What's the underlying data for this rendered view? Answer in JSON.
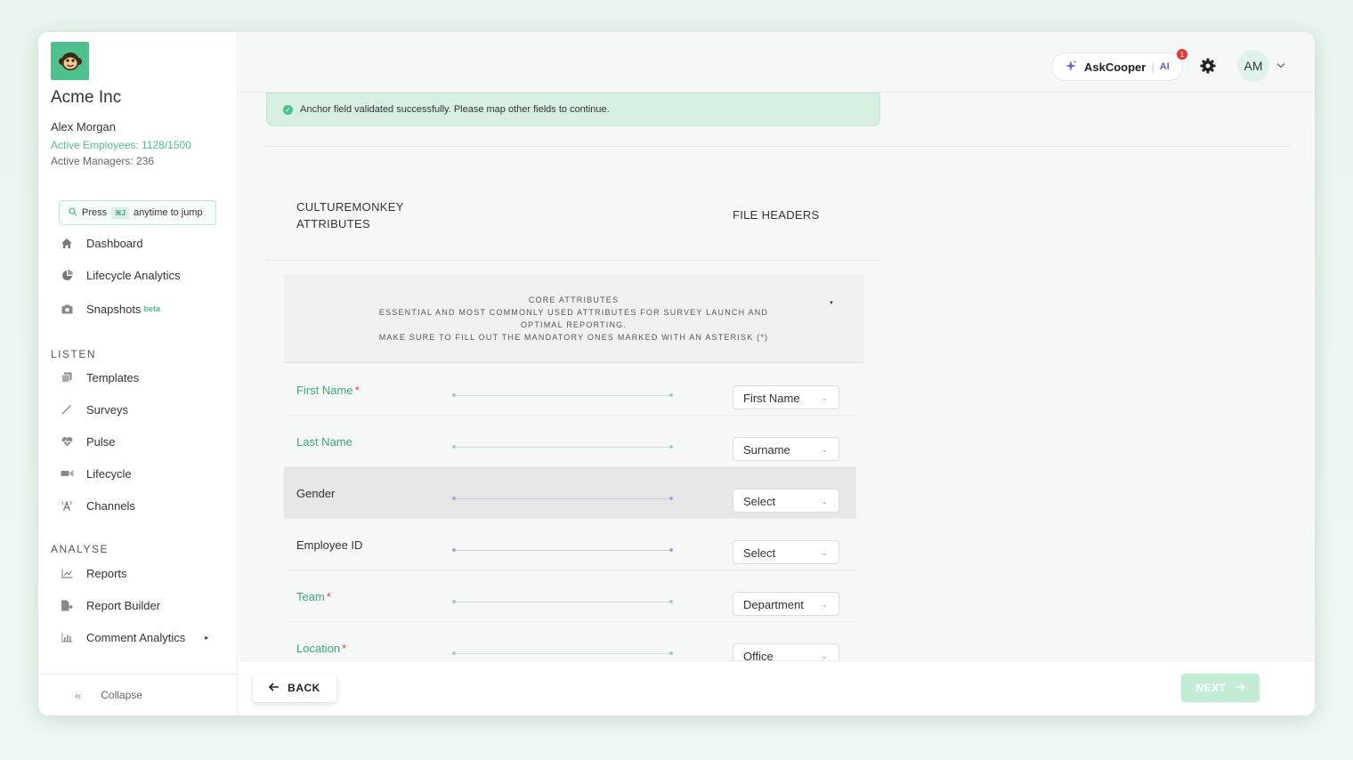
{
  "sidebar": {
    "company": "Acme Inc",
    "user_name": "Alex Morgan",
    "active_employees": "Active Employees: 1128/1500",
    "active_managers": "Active Managers: 236",
    "jump": {
      "press": "Press",
      "shortcut": "⌘J",
      "rest": "anytime to jump"
    },
    "items_main": [
      {
        "label": "Dashboard",
        "icon": "home-icon"
      },
      {
        "label": "Lifecycle Analytics",
        "icon": "pie-chart-icon"
      },
      {
        "label": "Snapshots",
        "icon": "camera-icon",
        "badge": "beta"
      }
    ],
    "section_listen": "LISTEN",
    "items_listen": [
      {
        "label": "Templates",
        "icon": "templates-icon"
      },
      {
        "label": "Surveys",
        "icon": "pen-icon"
      },
      {
        "label": "Pulse",
        "icon": "heartbeat-icon"
      },
      {
        "label": "Lifecycle",
        "icon": "lifecycle-icon"
      },
      {
        "label": "Channels",
        "icon": "broadcast-icon"
      }
    ],
    "section_analyse": "ANALYSE",
    "items_analyse": [
      {
        "label": "Reports",
        "icon": "line-chart-icon"
      },
      {
        "label": "Report Builder",
        "icon": "report-builder-icon"
      },
      {
        "label": "Comment Analytics",
        "icon": "bar-chart-icon"
      }
    ],
    "collapse": "Collapse"
  },
  "topbar": {
    "askcooper": "AskCooper",
    "ai": "AI",
    "notification_count": "1",
    "avatar_initials": "AM"
  },
  "toast": "Anchor field validated successfully. Please map other fields to continue.",
  "columns": {
    "left_line1": "CULTUREMONKEY",
    "left_line2": "ATTRIBUTES",
    "right": "FILE HEADERS"
  },
  "core": {
    "title": "CORE ATTRIBUTES",
    "line2": "ESSENTIAL AND MOST COMMONLY USED ATTRIBUTES FOR SURVEY LAUNCH AND OPTIMAL REPORTING.",
    "line3": "MAKE SURE TO FILL OUT THE MANDATORY ONES MARKED WITH AN ASTERISK (*)"
  },
  "rows": [
    {
      "label": "First Name",
      "required": "*",
      "value": "First Name"
    },
    {
      "label": "Last Name",
      "required": "",
      "value": "Surname"
    },
    {
      "label": "Gender",
      "required": "",
      "value": "Select"
    },
    {
      "label": "Employee ID",
      "required": "",
      "value": "Select"
    },
    {
      "label": "Team",
      "required": "*",
      "value": "Department"
    },
    {
      "label": "Location",
      "required": "*",
      "value": "Office"
    }
  ],
  "footer": {
    "back": "BACK",
    "next": "NEXT"
  },
  "colors": {
    "brand_green": "#4fc08d",
    "accent_purple": "#6a5acd",
    "error_red": "#e53935"
  }
}
